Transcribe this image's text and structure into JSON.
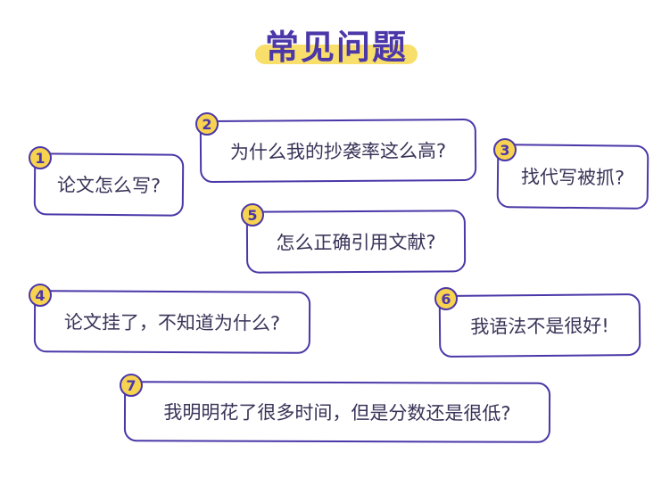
{
  "title": "常见问题",
  "questions": [
    {
      "num": "1",
      "text": "论文怎么写?"
    },
    {
      "num": "2",
      "text": "为什么我的抄袭率这么高?"
    },
    {
      "num": "3",
      "text": "找代写被抓?"
    },
    {
      "num": "4",
      "text": "论文挂了，不知道为什么?"
    },
    {
      "num": "5",
      "text": "怎么正确引用文献?"
    },
    {
      "num": "6",
      "text": "我语法不是很好!"
    },
    {
      "num": "7",
      "text": "我明明花了很多时间，但是分数还是很低?"
    }
  ],
  "colors": {
    "outline": "#4b37a8",
    "badge": "#f8d350",
    "highlight": "#f8de6a"
  }
}
